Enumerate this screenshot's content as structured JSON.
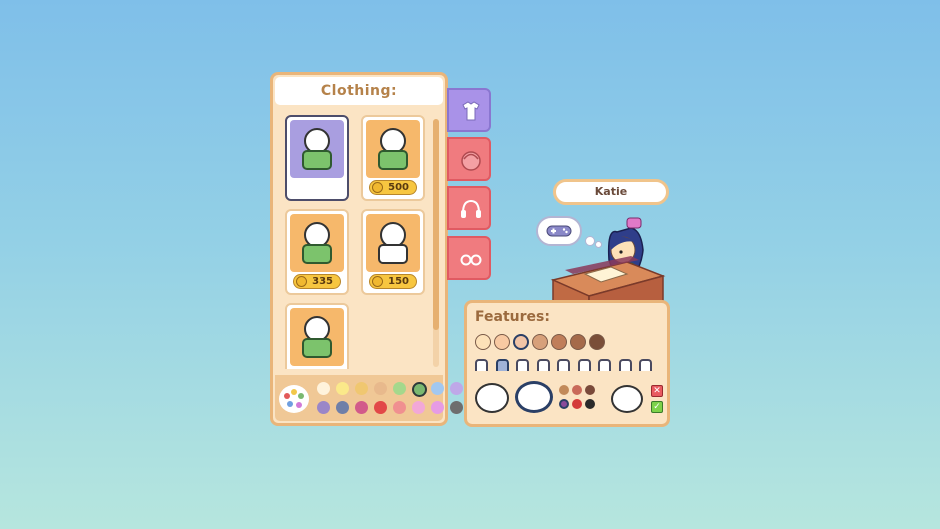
{
  "clothing": {
    "title": "Clothing:",
    "items": [
      {
        "price": "",
        "selected": true
      },
      {
        "price": "500"
      },
      {
        "price": "335"
      },
      {
        "price": "150"
      },
      {
        "price": ""
      }
    ],
    "scroll_fraction": 0.85
  },
  "palette": {
    "colors_row1": [
      "#fff3dc",
      "#fbe98a",
      "#f0c770",
      "#e8b98c",
      "#a5d88c",
      "#7ab870",
      "#a2c8f0",
      "#bfa8e8"
    ],
    "colors_row2": [
      "#9a86c8",
      "#6f7fa8",
      "#d25a8a",
      "#e24848",
      "#f09090",
      "#f2a8d8",
      "#e69be4",
      "#6e6e6e"
    ],
    "active_index": 5
  },
  "tabs": [
    {
      "icon": "shirt-icon",
      "color": "#a992e8"
    },
    {
      "icon": "hair-icon",
      "color": "#f07b7f"
    },
    {
      "icon": "headphones-icon",
      "color": "#f07b7f"
    },
    {
      "icon": "glasses-icon",
      "color": "#f07b7f"
    }
  ],
  "character": {
    "name": "Katie",
    "thought_icon": "gamepad-icon"
  },
  "features": {
    "title": "Features:",
    "skin_tones": [
      "#fde1b8",
      "#f8c9a2",
      "#f1c4a6",
      "#d7a07a",
      "#c07e5a",
      "#a56a4a",
      "#7a4e38"
    ],
    "active_skin": 2,
    "eye_count": 9,
    "active_eye": 1,
    "hair_colors": [
      "#c28a5a",
      "#c96a5a",
      "#7a4a3a",
      "#8a4a9a",
      "#d43a3a",
      "#2a2a2a"
    ],
    "cancel_icon": "close-icon",
    "confirm_icon": "check-icon"
  }
}
